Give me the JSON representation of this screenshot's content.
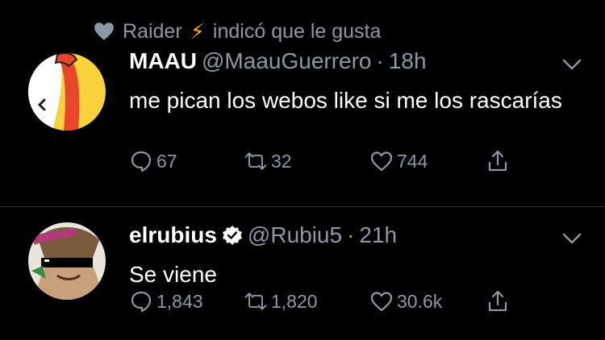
{
  "social_context": {
    "user": "Raider",
    "emoji": "⚡",
    "action": "indicó que le gusta"
  },
  "tweets": [
    {
      "name": "MAAU",
      "handle": "@MaauGuerrero",
      "separator": "·",
      "time": "18h",
      "text": "me pican los webos like si me los rascarías",
      "verified": false,
      "replies": "67",
      "retweets": "32",
      "likes": "744"
    },
    {
      "name": "elrubius",
      "handle": "@Rubiu5",
      "separator": "·",
      "time": "21h",
      "text": "Se viene",
      "verified": true,
      "replies": "1,843",
      "retweets": "1,820",
      "likes": "30.6k"
    }
  ],
  "colors": {
    "background": "#000000",
    "secondary_text": "#8b98a5",
    "verified": "#ffffff",
    "divider": "#2f3336"
  },
  "icons": [
    "heart-icon",
    "bolt-emoji",
    "chevron-down-icon",
    "reply-icon",
    "retweet-icon",
    "like-icon",
    "share-icon",
    "verified-badge-icon"
  ]
}
